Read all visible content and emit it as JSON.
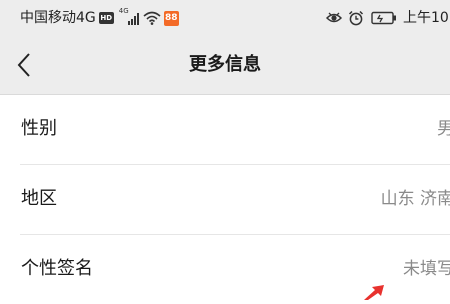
{
  "status_bar": {
    "carrier": "中国移动4G",
    "hd_badge": "HD",
    "network_type": "4G",
    "app_badge": "88",
    "time": "上午10"
  },
  "nav": {
    "title": "更多信息"
  },
  "rows": [
    {
      "label": "性别",
      "value": "男"
    },
    {
      "label": "地区",
      "value": "山东 济南"
    },
    {
      "label": "个性签名",
      "value": "未填写"
    }
  ],
  "colors": {
    "header_bg": "#ededed",
    "row_bg": "#ffffff",
    "label_text": "#1a1a1a",
    "value_text": "#8a8a8a",
    "annotation_red": "#e8322e"
  },
  "icons": [
    "hd-icon",
    "signal-icon",
    "wifi-icon",
    "app-notification-icon",
    "eye-icon",
    "alarm-icon",
    "battery-icon",
    "back-arrow-icon"
  ]
}
